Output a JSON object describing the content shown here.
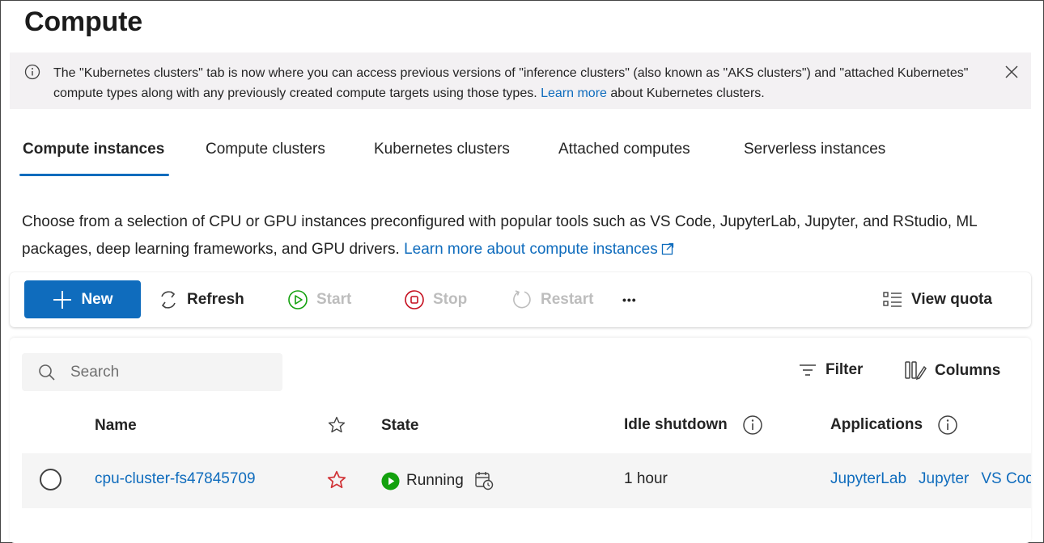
{
  "page": {
    "title": "Compute"
  },
  "banner": {
    "text_before": "The \"Kubernetes clusters\" tab is now where you can access previous versions of \"inference clusters\" (also known as \"AKS clusters\") and \"attached Kubernetes\" compute types along with any previously created compute targets using those types. ",
    "link": "Learn more",
    "text_after": " about Kubernetes clusters.",
    "info_icon": "info-icon",
    "close_icon": "close-icon"
  },
  "tabs": [
    {
      "label": "Compute instances",
      "active": true
    },
    {
      "label": "Compute clusters",
      "active": false
    },
    {
      "label": "Kubernetes clusters",
      "active": false
    },
    {
      "label": "Attached computes",
      "active": false
    },
    {
      "label": "Serverless instances",
      "active": false
    }
  ],
  "description": {
    "text": "Choose from a selection of CPU or GPU instances preconfigured with popular tools such as VS Code, JupyterLab, Jupyter, and RStudio, ML packages, deep learning frameworks, and GPU drivers. ",
    "link": "Learn more about compute instances"
  },
  "toolbar": {
    "new_label": "New",
    "refresh_label": "Refresh",
    "start_label": "Start",
    "stop_label": "Stop",
    "restart_label": "Restart",
    "more_label": "•••",
    "view_quota_label": "View quota"
  },
  "grid": {
    "search_placeholder": "Search",
    "filter_label": "Filter",
    "columns_label": "Columns",
    "headers": {
      "name": "Name",
      "state": "State",
      "idle_shutdown": "Idle shutdown",
      "applications": "Applications"
    },
    "rows": [
      {
        "name": "cpu-cluster-fs47845709",
        "favorite": true,
        "state": "Running",
        "idle_shutdown": "1 hour",
        "applications": [
          "JupyterLab",
          "Jupyter",
          "VS Code"
        ]
      }
    ]
  },
  "colors": {
    "accent": "#0f6cbd",
    "running": "#13a10e",
    "favorite": "#d13438",
    "stop": "#c50f1f",
    "start": "#13a10e"
  }
}
